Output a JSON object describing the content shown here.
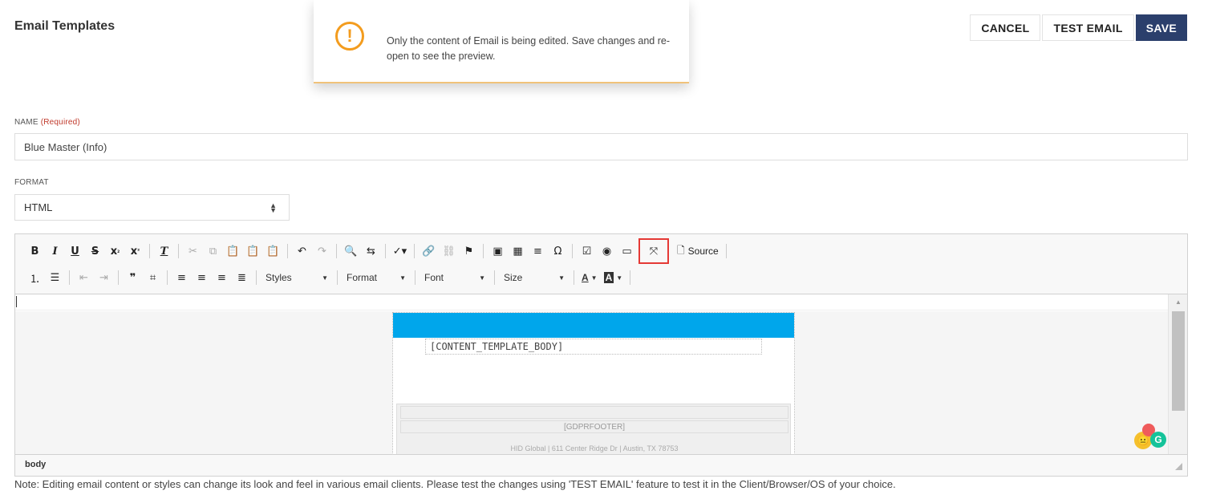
{
  "page": {
    "title": "Email Templates"
  },
  "actions": {
    "cancel": "CANCEL",
    "test_email": "TEST EMAIL",
    "save": "SAVE"
  },
  "toast": {
    "icon": "exclamation-circle-icon",
    "message": "Only the content of Email is being edited. Save changes and re-open to see the preview."
  },
  "form": {
    "name_label": "NAME",
    "name_required": "(Required)",
    "name_value": "Blue Master (Info)",
    "format_label": "FORMAT",
    "format_value": "HTML"
  },
  "toolbar": {
    "source_label": "Source",
    "styles_label": "Styles",
    "format_label": "Format",
    "font_label": "Font",
    "size_label": "Size"
  },
  "content": {
    "body_placeholder": "[CONTENT_TEMPLATE_BODY]",
    "gdpr_footer": "[GDPRFOOTER]",
    "address": "HID Global | 611 Center Ridge Dr | Austin, TX 78753",
    "header_color": "#00a6eb"
  },
  "statusbar": {
    "path": "body"
  },
  "note": "Note: Editing email content or styles can change its look and feel in various email clients. Please test the changes using 'TEST EMAIL' feature to test it in the Client/Browser/OS of your choice.",
  "colors": {
    "primary": "#2b3f6c",
    "warning": "#f39c1e",
    "highlight": "#e53935"
  }
}
